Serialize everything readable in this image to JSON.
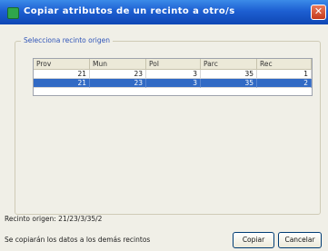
{
  "window": {
    "title": "Copiar atributos de un recinto a otro/s",
    "close_symbol": "✕"
  },
  "group": {
    "label": "Selecciona recinto origen"
  },
  "table": {
    "columns": [
      "Prov",
      "Mun",
      "Pol",
      "Parc",
      "Rec"
    ],
    "rows": [
      {
        "cells": [
          "21",
          "23",
          "3",
          "35",
          "1"
        ],
        "selected": false
      },
      {
        "cells": [
          "21",
          "23",
          "3",
          "35",
          "2"
        ],
        "selected": true
      }
    ]
  },
  "status": {
    "origin_label": "Recinto origen:",
    "origin_value": "21/23/3/35/2",
    "note": "Se copiarán los datos a los demás recintos"
  },
  "buttons": {
    "copy": "Copiar",
    "cancel": "Cancelar"
  },
  "colors": {
    "title_bar": "#1d5fd2",
    "selection": "#316ac5",
    "panel": "#f0efe7"
  },
  "icons": {
    "app": "app-icon",
    "close": "close-icon"
  }
}
